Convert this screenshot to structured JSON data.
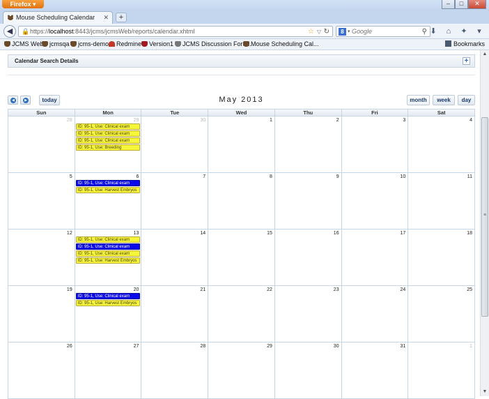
{
  "browser": {
    "app_menu_label": "Firefox",
    "window_controls": [
      "–",
      "□",
      "✕"
    ],
    "tab_title": "Mouse Scheduling Calendar",
    "new_tab_label": "+",
    "url_prefix": "https://",
    "url_host": "localhost",
    "url_rest": ":8443/jcms/jcmsWeb/reports/calendar.xhtml",
    "search_placeholder": "Google",
    "search_engine_letter": "8",
    "bookmarks": [
      "JCMS Web",
      "jcmsqa",
      "jcms-demo",
      "Redmine",
      "Version1",
      "JCMS Discussion Foru...",
      "Mouse Scheduling Cal..."
    ],
    "bookmarks_menu_label": "Bookmarks"
  },
  "search_panel": {
    "title": "Calendar Search Details",
    "expand_label": "+"
  },
  "calendar": {
    "title": "May 2013",
    "today_label": "today",
    "view_buttons": {
      "month": "month",
      "week": "week",
      "day": "day"
    },
    "active_view": "month",
    "day_names": [
      "Sun",
      "Mon",
      "Tue",
      "Wed",
      "Thu",
      "Fri",
      "Sat"
    ],
    "weeks": [
      [
        {
          "num": "28",
          "other": true,
          "events": []
        },
        {
          "num": "29",
          "other": true,
          "events": [
            {
              "text": "ID: 95-1, Use: Clinical exam",
              "color": "yellow"
            },
            {
              "text": "ID: 95-1, Use: Clinical exam",
              "color": "yellow"
            },
            {
              "text": "ID: 95-1, Use: Clinical exam",
              "color": "yellow"
            },
            {
              "text": "ID: 95-1, Use: Breeding",
              "color": "yellow"
            }
          ]
        },
        {
          "num": "30",
          "other": true,
          "events": []
        },
        {
          "num": "1",
          "events": []
        },
        {
          "num": "2",
          "events": []
        },
        {
          "num": "3",
          "events": []
        },
        {
          "num": "4",
          "events": []
        }
      ],
      [
        {
          "num": "5",
          "events": []
        },
        {
          "num": "6",
          "events": [
            {
              "text": "ID: 95-1, Use: Clinical exam",
              "color": "blue"
            },
            {
              "text": "ID: 95-1, Use: Harvest Embryos",
              "color": "yellow"
            }
          ]
        },
        {
          "num": "7",
          "events": []
        },
        {
          "num": "8",
          "events": []
        },
        {
          "num": "9",
          "events": []
        },
        {
          "num": "10",
          "events": []
        },
        {
          "num": "11",
          "events": []
        }
      ],
      [
        {
          "num": "12",
          "events": []
        },
        {
          "num": "13",
          "events": [
            {
              "text": "ID: 95-1, Use: Clinical exam",
              "color": "yellow"
            },
            {
              "text": "ID: 95-1, Use: Clinical exam",
              "color": "blue"
            },
            {
              "text": "ID: 95-1, Use: Clinical exam",
              "color": "yellow"
            },
            {
              "text": "ID: 95-1, Use: Harvest Embryos",
              "color": "yellow"
            }
          ]
        },
        {
          "num": "14",
          "events": []
        },
        {
          "num": "15",
          "events": []
        },
        {
          "num": "16",
          "events": []
        },
        {
          "num": "17",
          "events": []
        },
        {
          "num": "18",
          "events": []
        }
      ],
      [
        {
          "num": "19",
          "events": []
        },
        {
          "num": "20",
          "events": [
            {
              "text": "ID: 95-1, Use: Clinical exam",
              "color": "blue"
            },
            {
              "text": "ID: 95-1, Use: Harvest Embryos",
              "color": "yellow"
            }
          ]
        },
        {
          "num": "21",
          "events": []
        },
        {
          "num": "22",
          "events": []
        },
        {
          "num": "23",
          "events": []
        },
        {
          "num": "24",
          "events": []
        },
        {
          "num": "25",
          "events": []
        }
      ],
      [
        {
          "num": "26",
          "events": []
        },
        {
          "num": "27",
          "events": []
        },
        {
          "num": "28",
          "events": []
        },
        {
          "num": "29",
          "events": []
        },
        {
          "num": "30",
          "events": []
        },
        {
          "num": "31",
          "events": []
        },
        {
          "num": "1",
          "other": true,
          "events": []
        }
      ]
    ]
  },
  "colors": {
    "event_yellow": "#f5f53a",
    "event_blue": "#0a0ae8",
    "grid_border": "#c5d5ea"
  }
}
